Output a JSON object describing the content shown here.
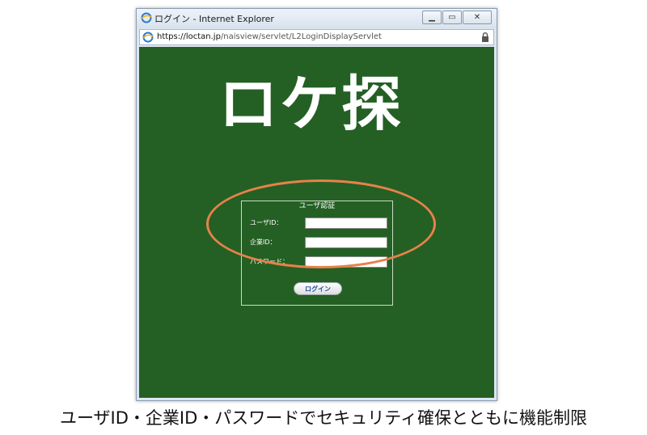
{
  "window": {
    "title": "ログイン - Internet Explorer",
    "controls": {
      "minimize": "▁",
      "maximize": "▭",
      "close": "✕"
    }
  },
  "address_bar": {
    "scheme_host": "https://loctan.jp",
    "path": "/naisview/servlet/L2LoginDisplayServlet",
    "lock_icon": "lock-icon"
  },
  "page": {
    "background_color": "#246024",
    "logo_text": "ロケ探",
    "auth": {
      "legend": "ユーザ認証",
      "fields": [
        {
          "label": "ユーザID：",
          "value": ""
        },
        {
          "label": "企業ID：",
          "value": ""
        },
        {
          "label": "パスワード：",
          "value": ""
        }
      ],
      "login_button": "ログイン"
    }
  },
  "annotation": {
    "highlight_color": "#e8814a"
  },
  "caption": "ユーザID・企業ID・パスワードでセキュリティ確保とともに機能制限"
}
